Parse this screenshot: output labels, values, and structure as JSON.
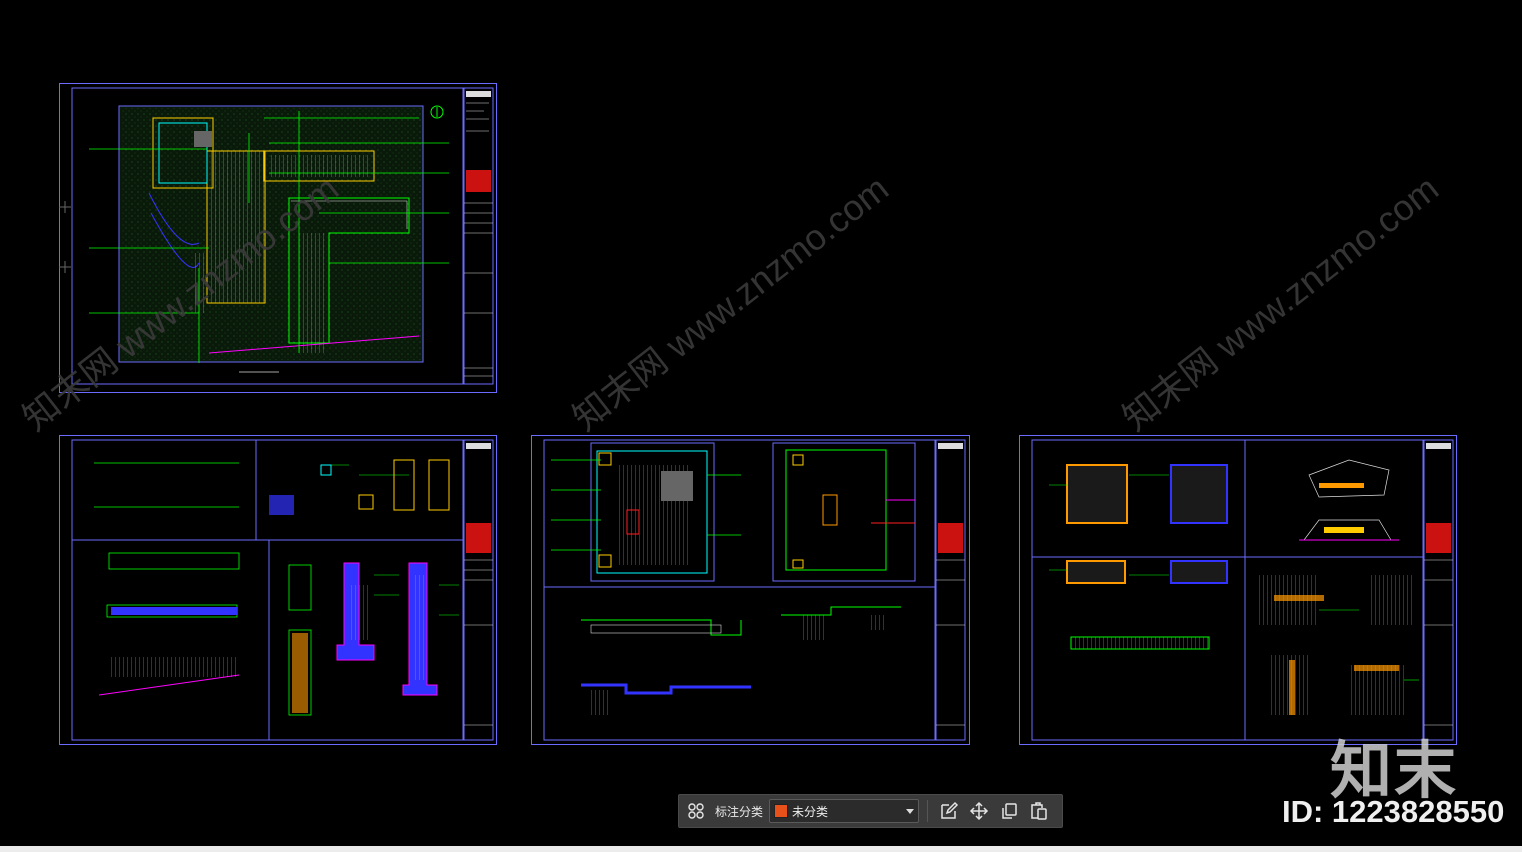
{
  "toolbar": {
    "label": "标注分类",
    "category_value": "未分类",
    "category_color": "#e8521a",
    "icons": [
      "grid-icon",
      "edit-icon",
      "move-icon",
      "copy-icon",
      "paste-icon"
    ]
  },
  "brand": {
    "logo_text": "知末",
    "id_text": "ID: 1223828550"
  },
  "watermark": {
    "text": "知末网 www.znzmo.com"
  },
  "colors": {
    "frame": "#6b6bff",
    "green": "#00ff00",
    "yellow": "#ffcc00",
    "magenta": "#ff00ff",
    "red": "#ff2020",
    "cyan": "#00ffff",
    "orange": "#ff9900",
    "blue": "#3333ff",
    "white": "#dddddd"
  }
}
